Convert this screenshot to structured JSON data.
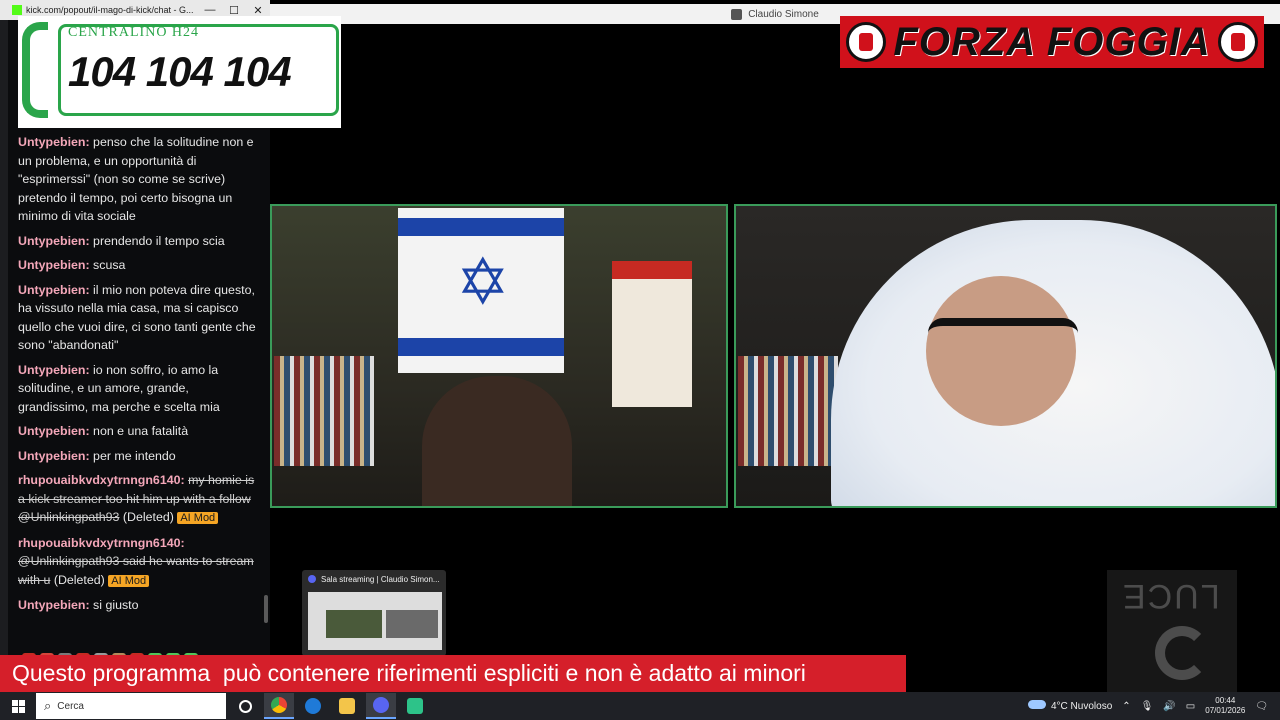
{
  "chat_window": {
    "title": "kick.com/popout/il-mago-di-kick/chat - G...",
    "minimize": "—",
    "maximize": "☐",
    "close": "✕"
  },
  "main_window": {
    "title": "Claudio Simone"
  },
  "centralino": {
    "label": "CENTRALINO H24",
    "number": "104 104 104"
  },
  "forza": {
    "text": "FORZA FOGGIA"
  },
  "chat": {
    "messages": [
      {
        "user": "Untypebien:",
        "text": "penso che la solitudine non e un problema, e un opportunità di \"esprimerssi\" (non so come se scrive) pretendo il tempo, poi certo bisogna un minimo di vita sociale"
      },
      {
        "user": "Untypebien:",
        "text": "prendendo il tempo scia"
      },
      {
        "user": "Untypebien:",
        "text": "scusa"
      },
      {
        "user": "Untypebien:",
        "text": "il mio non poteva dire questo, ha vissuto nella mia casa, ma si capisco quello che vuoi dire, ci sono tanti gente che sono \"abandonati\""
      },
      {
        "user": "Untypebien:",
        "text": "io non soffro, io amo la solitudine, e un amore, grande, grandissimo, ma perche e scelta mia"
      },
      {
        "user": "Untypebien:",
        "text": "non e una fatalità"
      },
      {
        "user": "Untypebien:",
        "text": "per me intendo"
      }
    ],
    "deleted": [
      {
        "user": "rhupouaibkvdxytrnngn6140:",
        "text": "my homie is a kick streamer too hit him up with a follow @Unlinkingpath93",
        "tag": "(Deleted)",
        "badge": "AI Mod"
      },
      {
        "user": "rhupouaibkvdxytrnngn6140:",
        "text": "@Unlinkingpath93 said he wants to stream with u",
        "tag": "(Deleted)",
        "badge": "AI Mod"
      }
    ],
    "last": {
      "user": "Untypebien:",
      "text": "si giusto"
    }
  },
  "thumbnail": {
    "title": "Sala streaming | Claudio Simon..."
  },
  "luce": {
    "text": "LUCE"
  },
  "disclaimer": "Questo programma  può contenere riferimenti espliciti e non è adatto ai minori",
  "taskbar": {
    "search_placeholder": "Cerca",
    "weather": "4°C  Nuvoloso",
    "time": "00:44",
    "date": "07/01/2026"
  }
}
